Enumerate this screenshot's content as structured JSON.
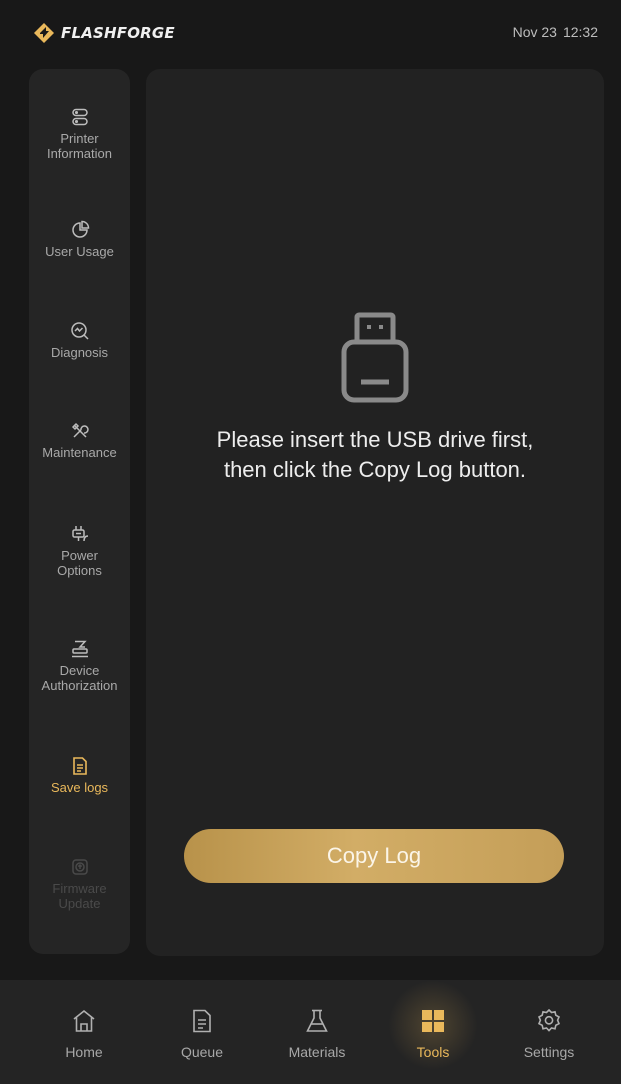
{
  "header": {
    "brand": "FLASHFORGE",
    "date": "Nov 23",
    "time": "12:32"
  },
  "sidebar": {
    "items": [
      {
        "label": "Printer\nInformation",
        "icon": "printer-info-icon",
        "state": "normal"
      },
      {
        "label": "User Usage",
        "icon": "pie-chart-icon",
        "state": "normal"
      },
      {
        "label": "Diagnosis",
        "icon": "diagnosis-icon",
        "state": "normal"
      },
      {
        "label": "Maintenance",
        "icon": "tools-icon",
        "state": "normal"
      },
      {
        "label": "Power\nOptions",
        "icon": "power-plug-icon",
        "state": "normal"
      },
      {
        "label": "Device\nAuthorization",
        "icon": "stamp-icon",
        "state": "normal"
      },
      {
        "label": "Save logs",
        "icon": "document-icon",
        "state": "active"
      },
      {
        "label": "Firmware\nUpdate",
        "icon": "upload-icon",
        "state": "disabled"
      }
    ]
  },
  "main": {
    "icon": "usb-drive-icon",
    "message_line1": "Please insert the USB drive first,",
    "message_line2": "then click the Copy Log button.",
    "button_label": "Copy Log"
  },
  "nav": {
    "items": [
      {
        "label": "Home",
        "icon": "home-icon"
      },
      {
        "label": "Queue",
        "icon": "queue-icon"
      },
      {
        "label": "Materials",
        "icon": "flask-icon"
      },
      {
        "label": "Tools",
        "icon": "grid-icon",
        "active": true
      },
      {
        "label": "Settings",
        "icon": "gear-icon"
      }
    ]
  },
  "colors": {
    "accent": "#e9b85b",
    "background": "#181818",
    "panel": "#222222"
  }
}
